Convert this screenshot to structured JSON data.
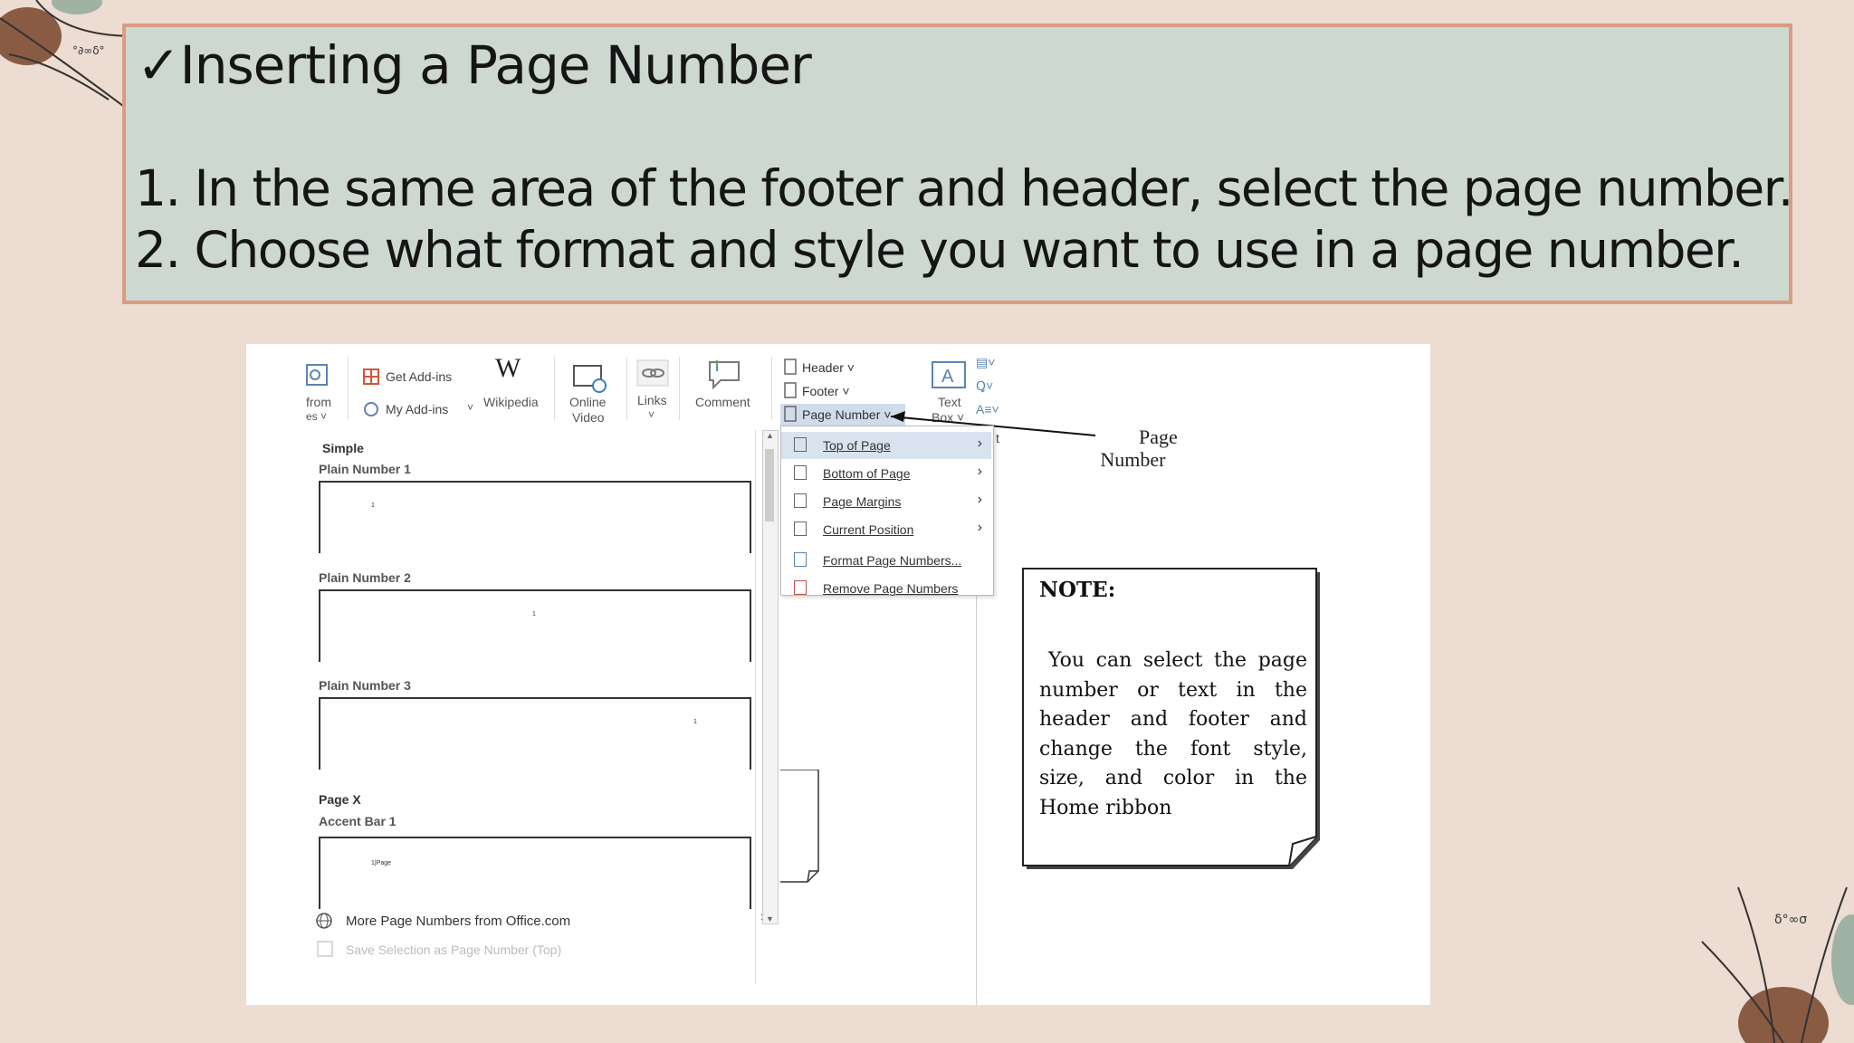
{
  "slide": {
    "title": "✓Inserting a Page Number",
    "step1": "1. In the same area of the footer and header, select the page number.",
    "step2": "2. Choose what format and style you want to use in a page number."
  },
  "ribbon": {
    "from_label": "from",
    "from_label2": "es ˅",
    "get_addins": "Get Add-ins",
    "my_addins": "My Add-ins",
    "wikipedia": "Wikipedia",
    "online_video_1": "Online",
    "online_video_2": "Video",
    "links": "Links",
    "comment": "Comment",
    "header": "Header ˅",
    "footer": "Footer ˅",
    "page_number": "Page Number ˅",
    "text_box_1": "Text",
    "text_box_2": "Box ˅"
  },
  "gallery": {
    "section_simple": "Simple",
    "plain1": "Plain Number 1",
    "plain2": "Plain Number 2",
    "plain3": "Plain Number 3",
    "section_pagex": "Page X",
    "accent1": "Accent Bar 1",
    "accent_preview": "1|Page",
    "more": "More Page Numbers from Office.com",
    "save": "Save Selection as Page Number (Top)"
  },
  "menu": {
    "items": [
      {
        "label": "Top of Page",
        "submenu": true
      },
      {
        "label": "Bottom of Page",
        "submenu": true
      },
      {
        "label": "Page Margins",
        "submenu": true
      },
      {
        "label": "Current Position",
        "submenu": true
      },
      {
        "label": "Format Page Numbers...",
        "submenu": false
      },
      {
        "label": "Remove Page Numbers",
        "submenu": false
      }
    ]
  },
  "annotation": {
    "line1": "Page",
    "line2": "Number"
  },
  "note": {
    "title": "NOTE:",
    "body": "You can select the page number or text in the header and footer and change the font style, size, and color in the Home ribbon"
  },
  "colors": {
    "background": "#ecdcd2",
    "title_box": "#cdd8d0",
    "title_border": "#d99c82"
  }
}
